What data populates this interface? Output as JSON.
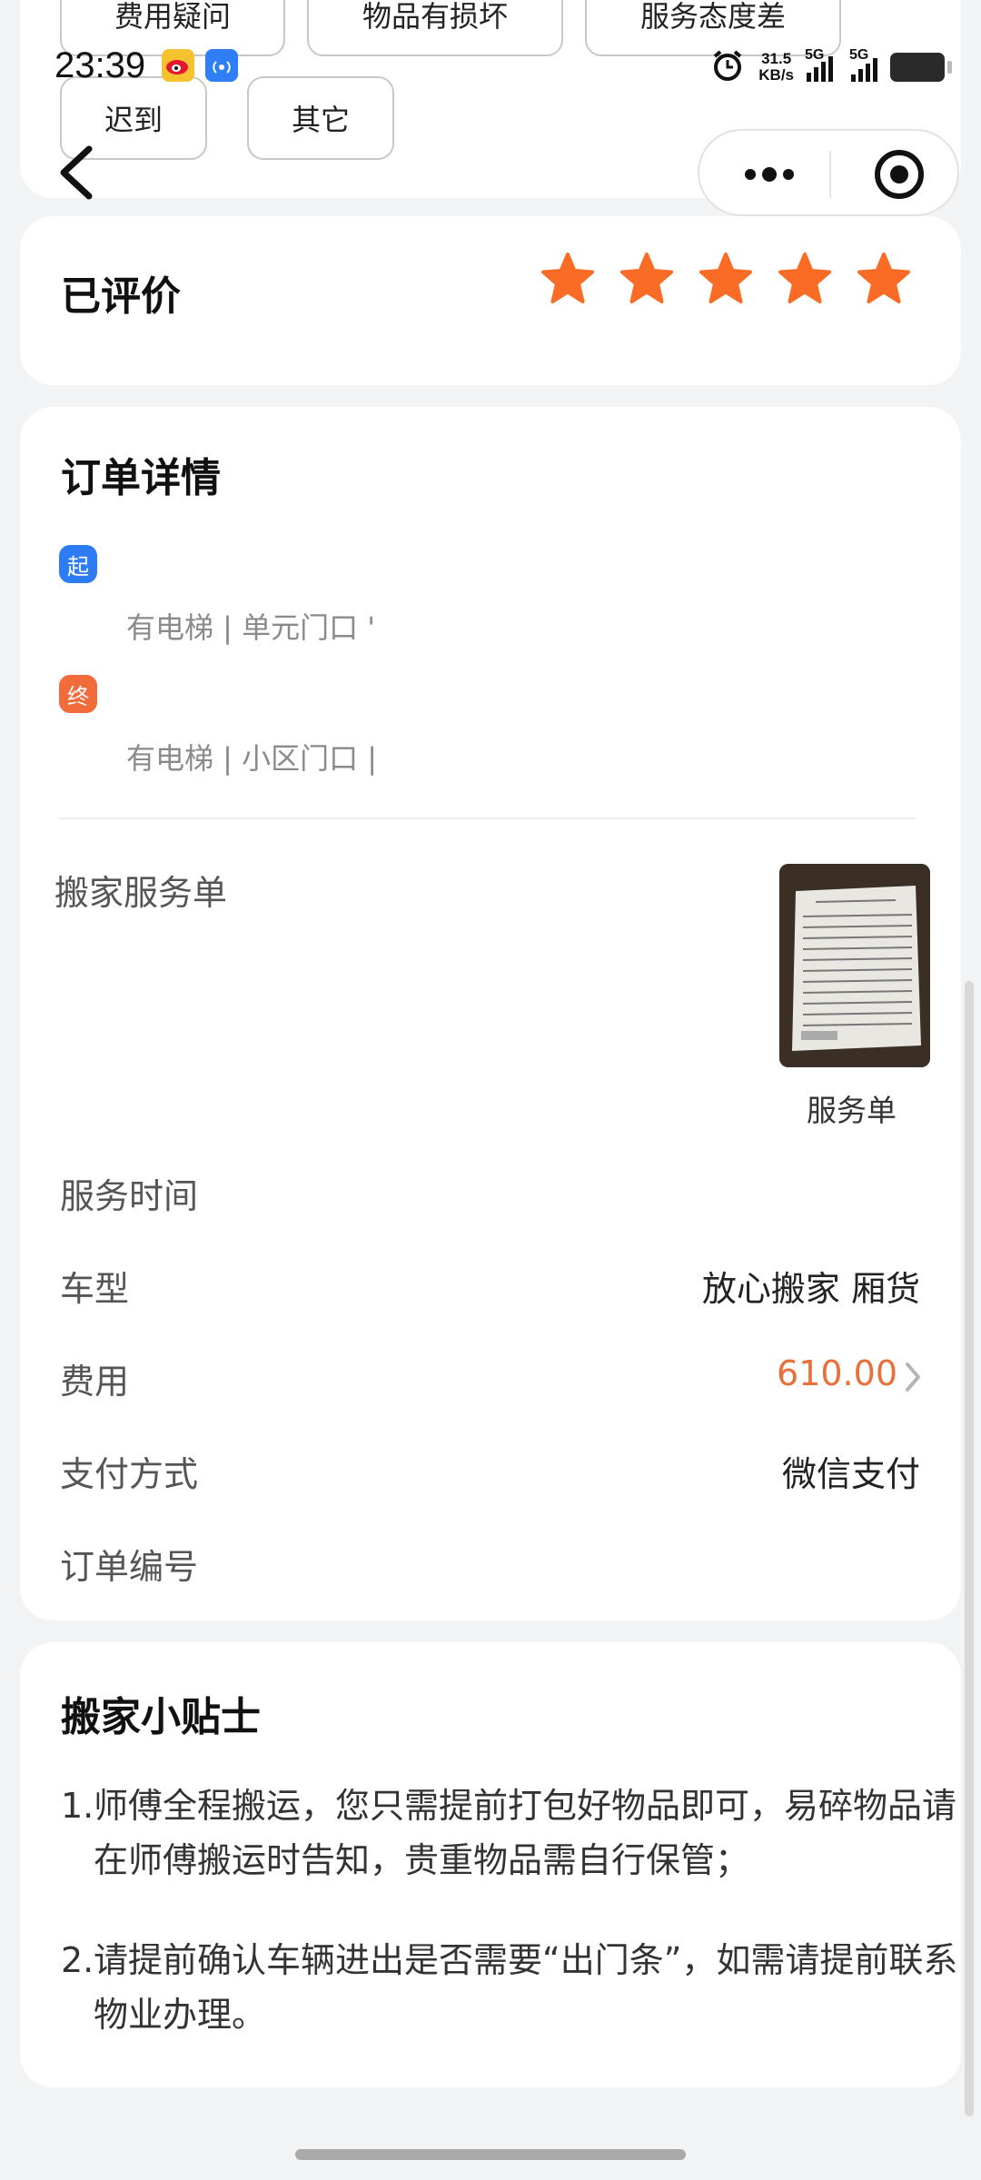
{
  "feedback_chips": {
    "row1": [
      "费用疑问",
      "物品有损坏",
      "服务态度差"
    ],
    "row2": [
      "迟到",
      "其它"
    ]
  },
  "status_bar": {
    "time": "23:39",
    "net_speed_value": "31.5",
    "net_speed_unit": "KB/s",
    "sim1": "5G",
    "sim2": "5G"
  },
  "nav": {
    "back_icon": "chevron-left-icon",
    "more_icon": "more-dots-icon",
    "close_icon": "target-circle-icon"
  },
  "rating": {
    "title": "已评价",
    "stars": 5,
    "max_stars": 5,
    "star_color": "#fa6c25"
  },
  "order": {
    "title": "订单详情",
    "start_badge": "起",
    "start_detail": "有电梯 | 单元门口 '",
    "end_badge": "终",
    "end_detail": "有电梯 | 小区门口 |",
    "service_doc_label": "搬家服务单",
    "service_doc_caption": "服务单",
    "rows": [
      {
        "label": "服务时间",
        "value": ""
      },
      {
        "label": "车型",
        "value": "放心搬家 厢货"
      },
      {
        "label": "费用",
        "value": "610.00"
      },
      {
        "label": "支付方式",
        "value": "微信支付"
      },
      {
        "label": "订单编号",
        "value": ""
      }
    ],
    "colors": {
      "start": "#2d7cf6",
      "end": "#f26b3a",
      "fee": "#e8703a"
    }
  },
  "tips": {
    "title": "搬家小贴士",
    "items": [
      {
        "num": "1.",
        "text": "师傅全程搬运，您只需提前打包好物品即可，易碎物品请在师傅搬运时告知，贵重物品需自行保管；"
      },
      {
        "num": "2.",
        "text": "请提前确认车辆进出是否需要“出门条”，如需请提前联系物业办理。"
      }
    ]
  }
}
